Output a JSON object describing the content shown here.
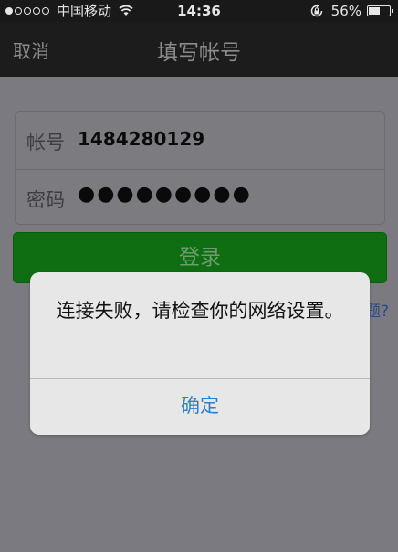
{
  "status_bar": {
    "carrier": "中国移动",
    "time": "14:36",
    "battery_pct": "56%",
    "battery_level": 0.56,
    "signal_bars_filled": 1,
    "signal_bars_total": 5
  },
  "nav": {
    "cancel_label": "取消",
    "title": "填写帐号"
  },
  "form": {
    "account_label": "帐号",
    "account_value": "1484280129",
    "password_label": "密码",
    "password_value": "●●●●●●●●●"
  },
  "login_button": "登录",
  "faq_link": "题?",
  "alert": {
    "message": "连接失败，请检查你的网络设置。",
    "confirm_label": "确定"
  },
  "colors": {
    "login_green": "#0f6e12",
    "alert_button_blue": "#2e7fc4"
  }
}
